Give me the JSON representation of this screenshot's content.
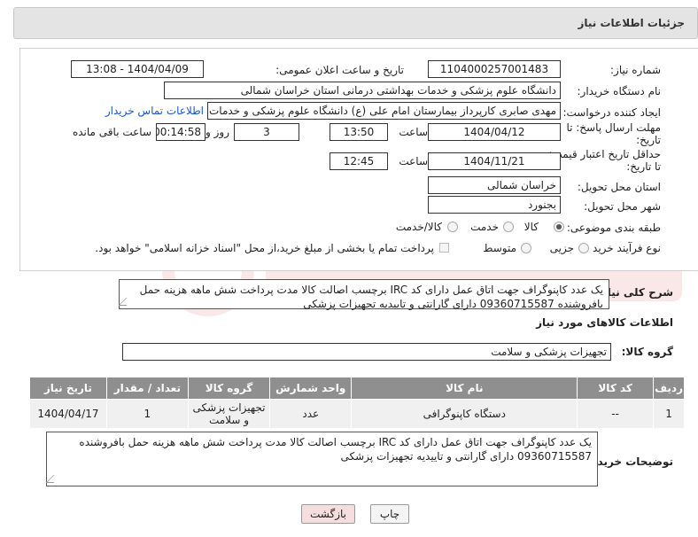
{
  "header": {
    "title": "جزئیات اطلاعات نیاز"
  },
  "form": {
    "need_number_label": "شماره نیاز:",
    "need_number": "1104000257001483",
    "announce_label": "تاریخ و ساعت اعلان عمومی:",
    "announce_value": "1404/04/09 - 13:08",
    "buyer_org_label": "نام دستگاه خریدار:",
    "buyer_org": "دانشگاه علوم پزشکی و خدمات بهداشتی درمانی استان خراسان شمالی",
    "creator_label": "ایجاد کننده درخواست:",
    "creator": "مهدی صابری کارپرداز بیمارستان امام علی (ع) دانشگاه علوم پزشکی و خدمات بهداشتی",
    "contact_link": "اطلاعات تماس خریدار",
    "deadline_label_1": "مهلت ارسال پاسخ: تا",
    "deadline_label_2": "تاریخ:",
    "deadline_date": "1404/04/12",
    "time_label": "ساعت",
    "deadline_time": "13:50",
    "days_value": "3",
    "days_label": "روز و",
    "remaining_time": "00:14:58",
    "remaining_label": "ساعت باقی مانده",
    "min_price_label_1": "حداقل تاریخ اعتبار قیمت:",
    "min_price_label_2": "تا تاریخ:",
    "price_date": "1404/11/21",
    "price_time": "12:45",
    "province_label": "استان محل تحویل:",
    "province": "خراسان شمالی",
    "city_label": "شهر محل تحویل:",
    "city": "بجنورد",
    "category_label": "طبقه بندی موضوعی:",
    "category_options": [
      "کالا",
      "خدمت",
      "کالا/خدمت"
    ],
    "category_selected": "کالا",
    "process_label": "نوع فرآیند خرید :",
    "process_options": [
      "جزیی",
      "متوسط"
    ],
    "payment_note": "پرداخت تمام یا بخشی از مبلغ خرید،از محل \"اسناد خزانه اسلامی\" خواهد بود."
  },
  "need_description": {
    "label": "شرح کلی نیاز:",
    "text": "یک عدد کاپنوگراف  جهت اتاق عمل دارای کد IRC برچسب اصالت کالا مدت پرداخت شش ماهه هزینه حمل بافروشنده 09360715587 دارای گارانتی و تاییدیه تجهیزات پزشکی"
  },
  "goods_info": {
    "title": "اطلاعات کالاهای مورد نیاز",
    "group_label": "گروه کالا:",
    "group_value": "تجهیزات پزشکی و سلامت"
  },
  "table": {
    "headers": [
      "ردیف",
      "کد کالا",
      "نام کالا",
      "واحد شمارش",
      "گروه کالا",
      "تعداد / مقدار",
      "تاریخ نیاز"
    ],
    "rows": [
      [
        "1",
        "--",
        "دستگاه کاپنوگرافی",
        "عدد",
        "تجهیزات پزشکی و سلامت",
        "1",
        "1404/04/17"
      ]
    ]
  },
  "buyer_notes": {
    "label": "توضیحات خریدار:",
    "text": "یک عدد کاپنوگراف  جهت اتاق عمل دارای کد IRC برچسب اصالت کالا مدت پرداخت شش ماهه هزینه حمل بافروشنده 09360715587 دارای گارانتی و تاییدیه تجهیزات پزشکی"
  },
  "buttons": {
    "print": "چاپ",
    "back": "بازگشت"
  },
  "colors": {
    "header_bg": "#e4e4e4",
    "table_header": "#8f8f8f",
    "link": "#1a56c8",
    "back_btn": "#f6dede"
  }
}
